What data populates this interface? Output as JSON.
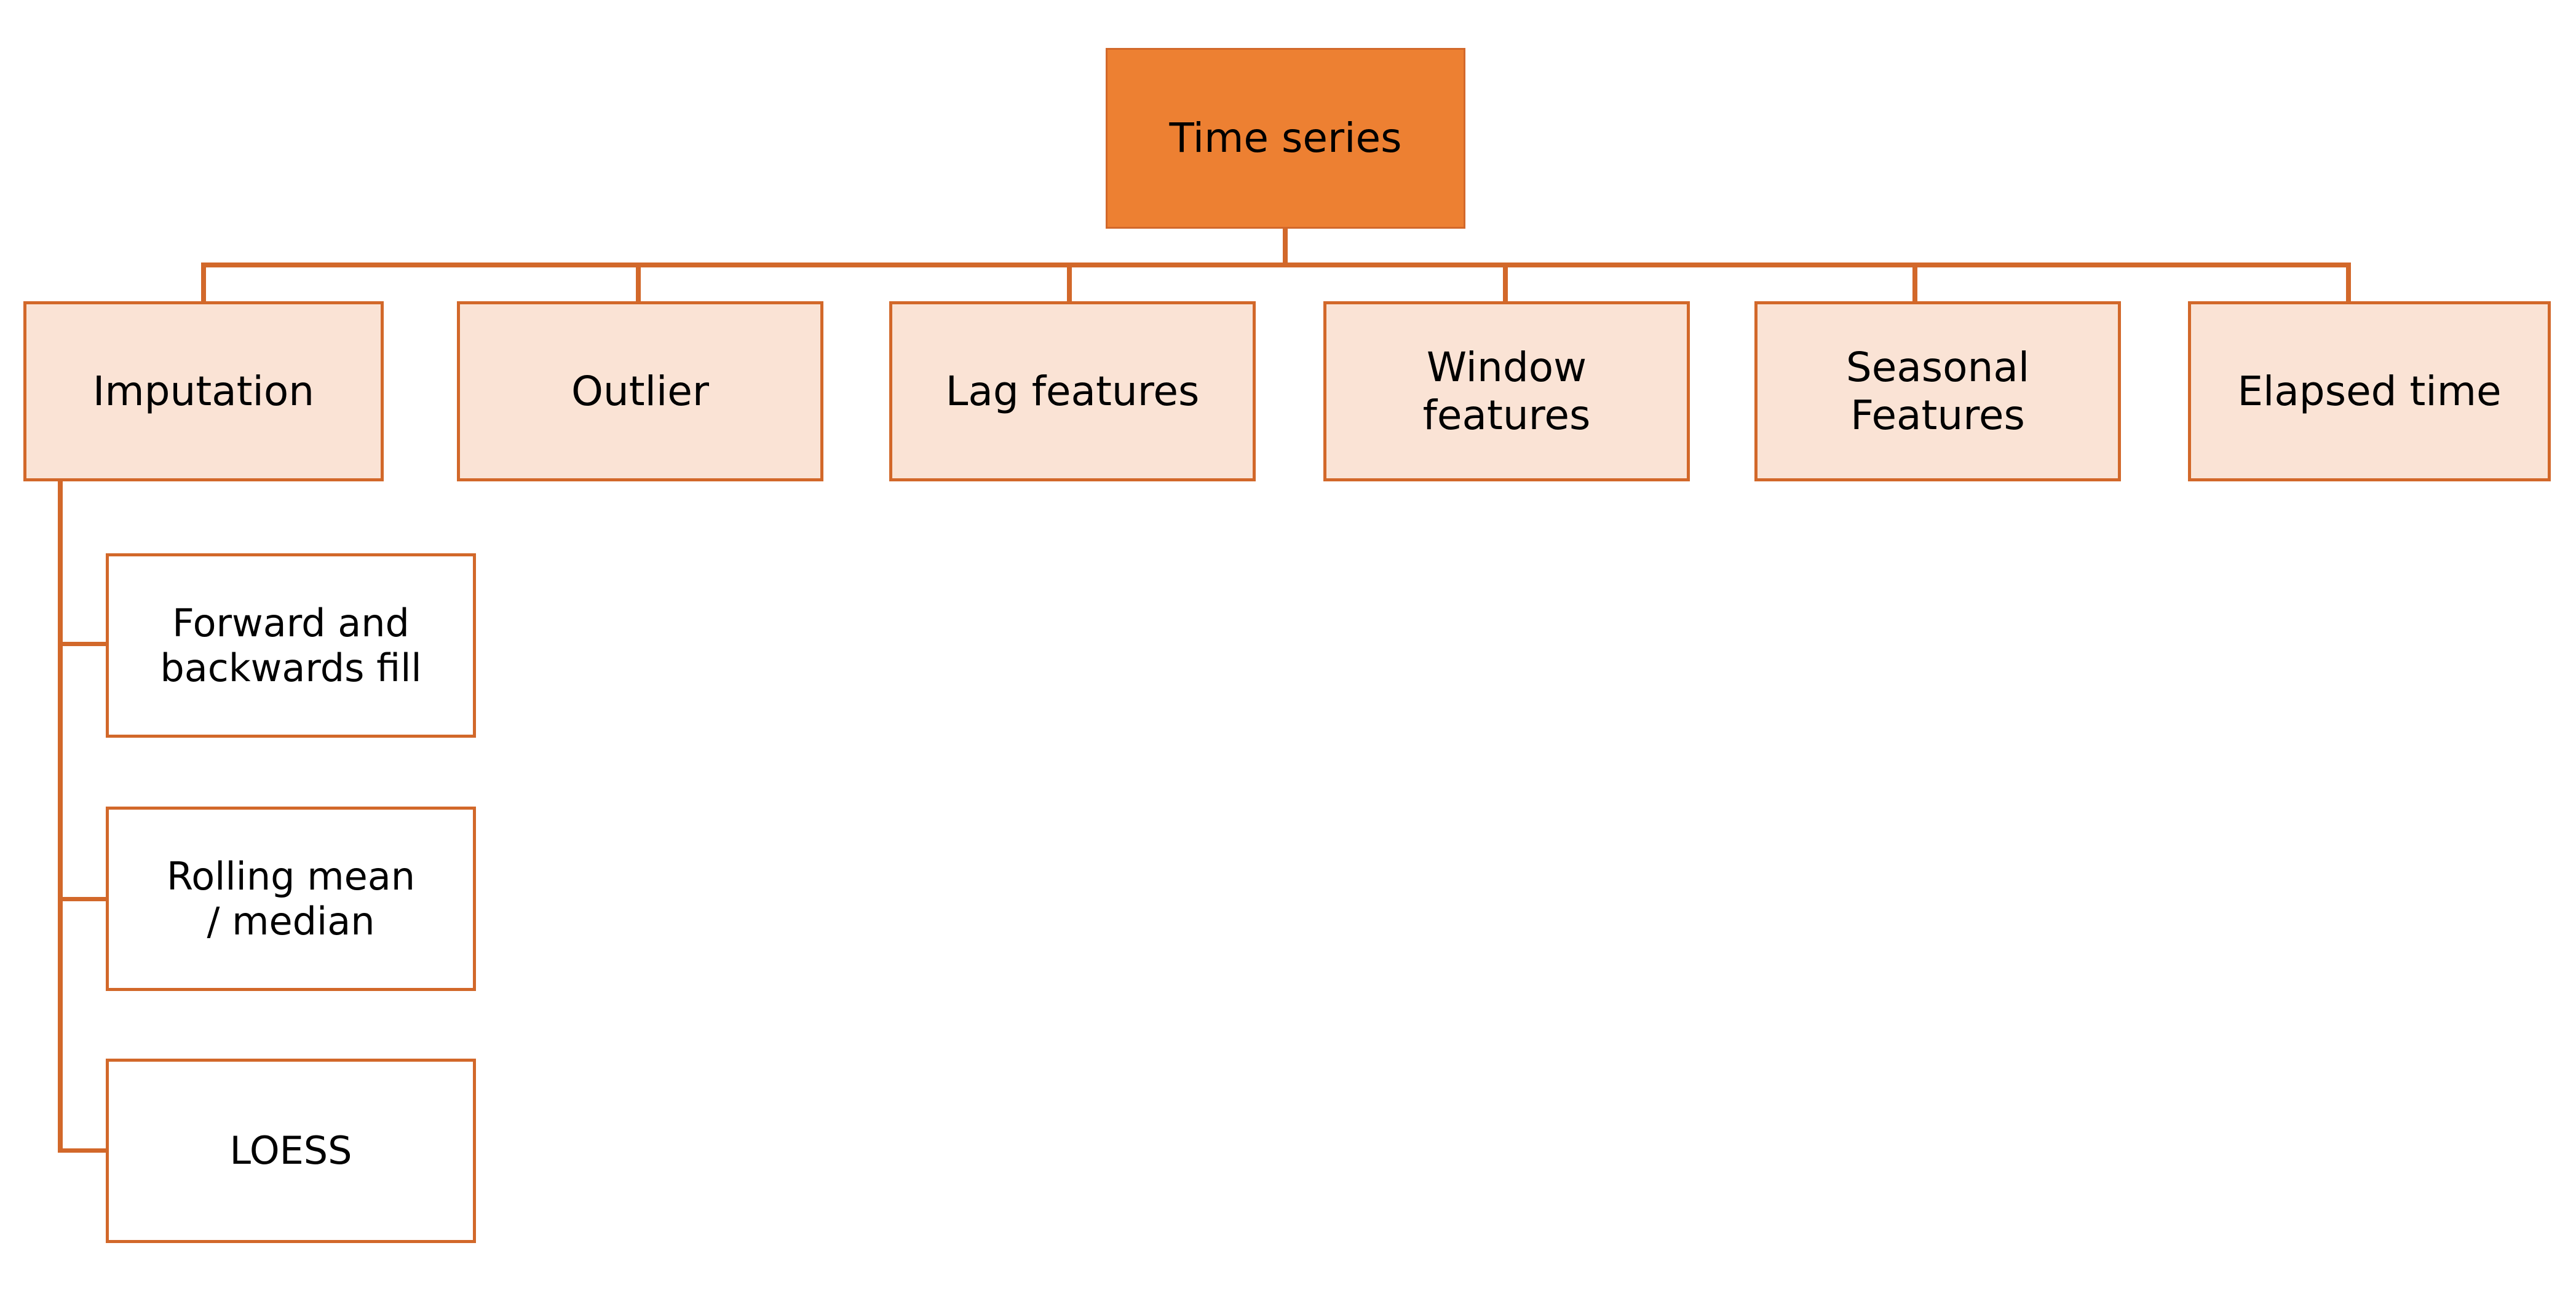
{
  "diagram": {
    "title_node": {
      "label": "Time series",
      "fill": "#ED8032",
      "border": "#D2682A"
    },
    "level2_fill": "#FAE3D5",
    "level3_fill": "#FFFFFF",
    "line_color": "#D2682A",
    "nodes": {
      "root": "Time series",
      "imputation": "Imputation",
      "outlier": "Outlier",
      "lag_features": "Lag features",
      "window_features": "Window\nfeatures",
      "seasonal_features": "Seasonal\nFeatures",
      "elapsed_time": "Elapsed time",
      "forward_backward_fill": "Forward and\nbackwards fill",
      "rolling_mean_median": "Rolling mean\n/ median",
      "loess": "LOESS"
    }
  }
}
